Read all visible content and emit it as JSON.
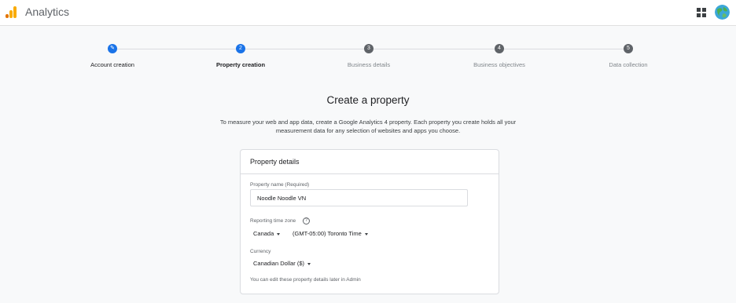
{
  "header": {
    "app_title": "Analytics",
    "icons": [
      "analytics-logo-icon",
      "apps-grid-icon",
      "account-avatar"
    ]
  },
  "stepper": {
    "steps": [
      {
        "label": "Account creation",
        "marker": "✎",
        "state": "done"
      },
      {
        "label": "Property creation",
        "marker": "2",
        "state": "current"
      },
      {
        "label": "Business details",
        "marker": "3",
        "state": "upcoming"
      },
      {
        "label": "Business objectives",
        "marker": "4",
        "state": "upcoming"
      },
      {
        "label": "Data collection",
        "marker": "5",
        "state": "upcoming"
      }
    ]
  },
  "main": {
    "title": "Create a property",
    "intro_line1": "To measure your web and app data, create a Google Analytics 4 property. Each property you create holds all your",
    "intro_line2": "measurement data for any selection of websites and apps you choose."
  },
  "card": {
    "title": "Property details",
    "property_name_label": "Property name (Required)",
    "property_name_value": "Noodle Noodle VN",
    "timezone_label": "Reporting time zone",
    "help_glyph": "?",
    "country_value": "Canada",
    "timezone_value": "(GMT-05:00) Toronto Time",
    "currency_label": "Currency",
    "currency_value": "Canadian Dollar ($)",
    "footnote": "You can edit these property details later in Admin"
  },
  "colors": {
    "accent": "#1a73e8",
    "inactive_step": "#5f6368",
    "logo_orange": "#f9ab00",
    "logo_dark_orange": "#e37400"
  }
}
